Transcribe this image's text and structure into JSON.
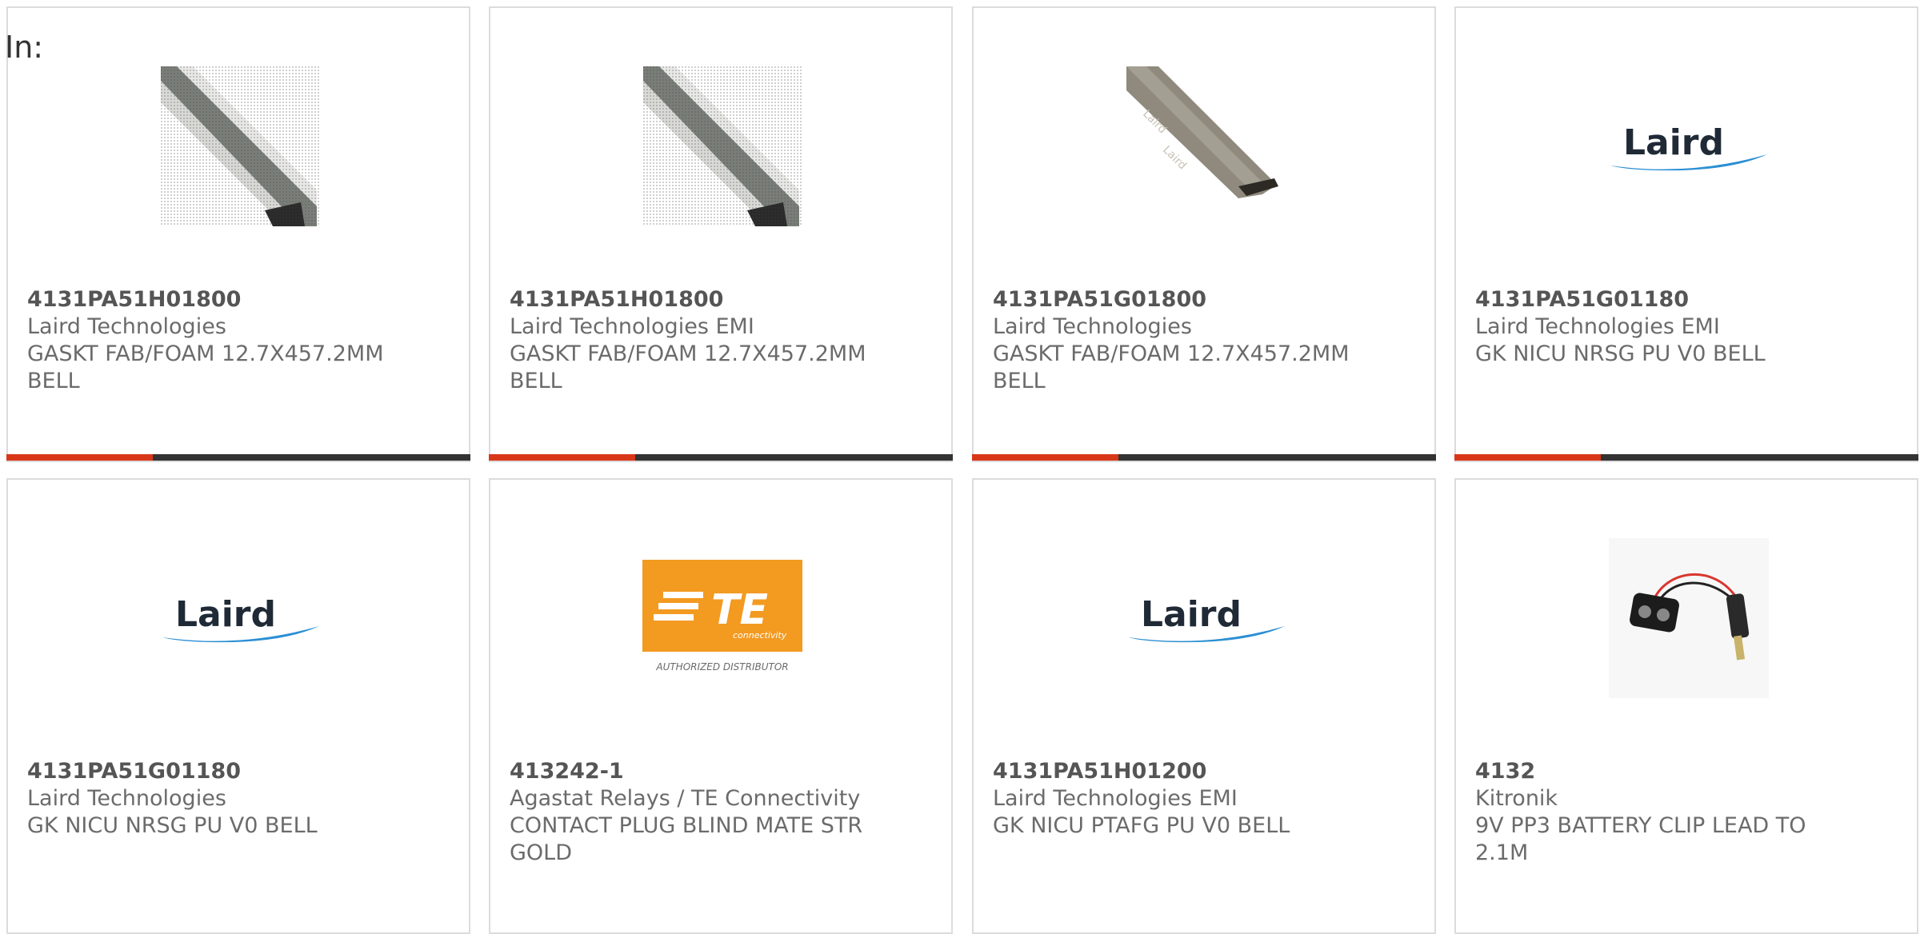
{
  "filter": {
    "in_label": "In:"
  },
  "accent_color": "#d8371a",
  "bar_color": "#333333",
  "products": [
    {
      "part_number": "4131PA51H01800",
      "manufacturer": "Laird Technologies",
      "description": "GASKT FAB/FOAM 12.7X457.2MM BELL",
      "image": "silver-gasket-icon"
    },
    {
      "part_number": "4131PA51H01800",
      "manufacturer": "Laird Technologies EMI",
      "description": "GASKT FAB/FOAM 12.7X457.2MM BELL",
      "image": "silver-gasket-icon"
    },
    {
      "part_number": "4131PA51G01800",
      "manufacturer": "Laird Technologies",
      "description": "GASKT FAB/FOAM 12.7X457.2MM BELL",
      "image": "bronze-gasket-icon"
    },
    {
      "part_number": "4131PA51G01180",
      "manufacturer": "Laird Technologies EMI",
      "description": "GK NICU NRSG PU V0 BELL",
      "image": "laird-logo",
      "logo_text": "Laird"
    },
    {
      "part_number": "4131PA51G01180",
      "manufacturer": "Laird Technologies",
      "description": "GK NICU NRSG PU V0 BELL",
      "image": "laird-logo",
      "logo_text": "Laird"
    },
    {
      "part_number": "413242-1",
      "manufacturer": "Agastat Relays / TE Connectivity",
      "description": "CONTACT PLUG BLIND MATE STR GOLD",
      "image": "te-connectivity-logo",
      "logo_text": "TE",
      "logo_subtext": "connectivity",
      "logo_caption": "AUTHORIZED DISTRIBUTOR"
    },
    {
      "part_number": "4131PA51H01200",
      "manufacturer": "Laird Technologies EMI",
      "description": "GK NICU PTAFG PU V0 BELL",
      "image": "laird-logo",
      "logo_text": "Laird"
    },
    {
      "part_number": "4132",
      "manufacturer": "Kitronik",
      "description": "9V PP3 BATTERY CLIP LEAD TO 2.1M",
      "image": "battery-clip-icon"
    }
  ]
}
